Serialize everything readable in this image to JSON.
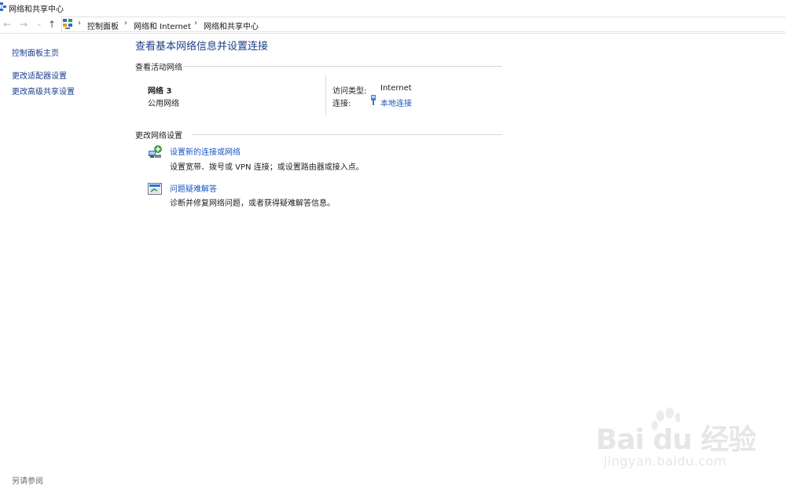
{
  "window": {
    "title": "网络和共享中心"
  },
  "address_bar": {
    "back": "←",
    "forward": "→",
    "history": "⌄",
    "up": "↑",
    "separator": "›",
    "breadcrumbs": [
      "控制面板",
      "网络和 Internet",
      "网络和共享中心"
    ]
  },
  "sidebar": {
    "home_link": "控制面板主页",
    "links": [
      "更改适配器设置",
      "更改高级共享设置"
    ],
    "see_also": "另请参阅"
  },
  "main": {
    "title": "查看基本网络信息并设置连接",
    "active_networks_heading": "查看活动网络",
    "network": {
      "name": "网络  3",
      "type": "公用网络",
      "access_type_label": "访问类型:",
      "access_type_value": "Internet",
      "connections_label": "连接:",
      "connection_name": "本地连接"
    },
    "change_settings_heading": "更改网络设置",
    "tasks": [
      {
        "icon": "network-setup-icon",
        "title": "设置新的连接或网络",
        "description": "设置宽带、拨号或 VPN 连接；或设置路由器或接入点。"
      },
      {
        "icon": "troubleshoot-icon",
        "title": "问题疑难解答",
        "description": "诊断并修复网络问题，或者获得疑难解答信息。"
      }
    ]
  },
  "watermark": {
    "brand": "Bai du 经验",
    "url": "jingyan.baidu.com"
  },
  "colors": {
    "link": "#1a56c0",
    "title": "#1e3f8a",
    "sidebar_link": "#1a3d8c"
  }
}
